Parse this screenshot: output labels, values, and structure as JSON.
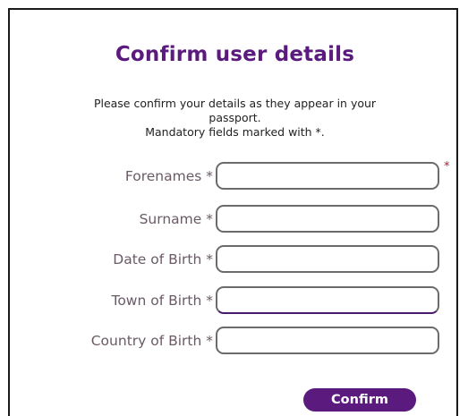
{
  "form": {
    "title": "Confirm user details",
    "intro_line1": "Please confirm your details as they appear in your",
    "intro_line2": "passport.",
    "intro_line3": "Mandatory fields marked with *.",
    "fields": [
      {
        "label": "Forenames *",
        "value": "",
        "required_marker": "*"
      },
      {
        "label": "Surname *",
        "value": ""
      },
      {
        "label": "Date of Birth *",
        "value": ""
      },
      {
        "label": "Town of Birth *",
        "value": ""
      },
      {
        "label": "Country of Birth *",
        "value": ""
      }
    ],
    "confirm_label": "Confirm"
  },
  "colors": {
    "accent": "#5a1a7e",
    "label_text": "#6a5a66",
    "required_marker": "#b0202a"
  }
}
